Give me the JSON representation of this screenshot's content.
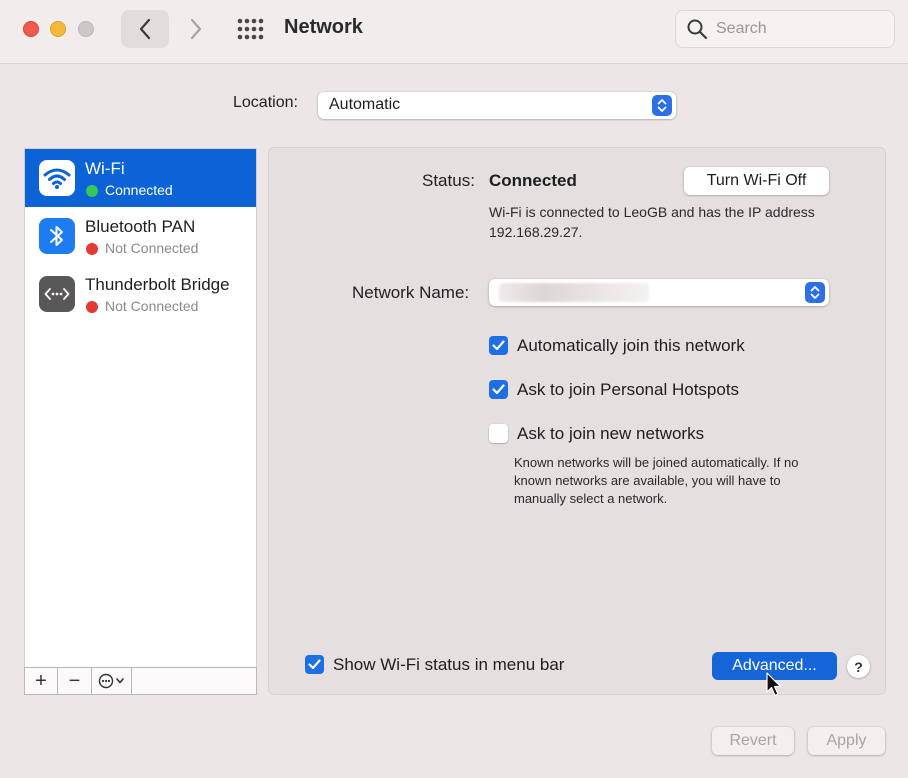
{
  "window": {
    "title": "Network",
    "search_placeholder": "Search"
  },
  "location": {
    "label": "Location:",
    "value": "Automatic"
  },
  "services": [
    {
      "name": "Wi-Fi",
      "status": "Connected",
      "status_color": "#34c759",
      "icon": "wifi-icon"
    },
    {
      "name": "Bluetooth PAN",
      "status": "Not Connected",
      "status_color": "#e53935",
      "icon": "bluetooth-icon"
    },
    {
      "name": "Thunderbolt Bridge",
      "status": "Not Connected",
      "status_color": "#e53935",
      "icon": "thunderbolt-bridge-icon"
    }
  ],
  "sidebar_tools": {
    "add": "+",
    "remove": "−"
  },
  "detail": {
    "status_label": "Status:",
    "status_value": "Connected",
    "turn_off_label": "Turn Wi-Fi Off",
    "status_description": "Wi-Fi is connected to LeoGB and has the IP address 192.168.29.27.",
    "network_name_label": "Network Name:",
    "options": [
      {
        "label": "Automatically join this network",
        "checked": true
      },
      {
        "label": "Ask to join Personal Hotspots",
        "checked": true
      },
      {
        "label": "Ask to join new networks",
        "checked": false
      }
    ],
    "known_networks_note": "Known networks will be joined automatically. If no known networks are available, you will have to manually select a network.",
    "show_status_label": "Show Wi-Fi status in menu bar",
    "show_status_checked": true,
    "advanced_label": "Advanced...",
    "help_label": "?"
  },
  "footer": {
    "revert_label": "Revert",
    "apply_label": "Apply"
  },
  "colors": {
    "accent": "#1565d8",
    "selected_row": "#0b63d5"
  }
}
